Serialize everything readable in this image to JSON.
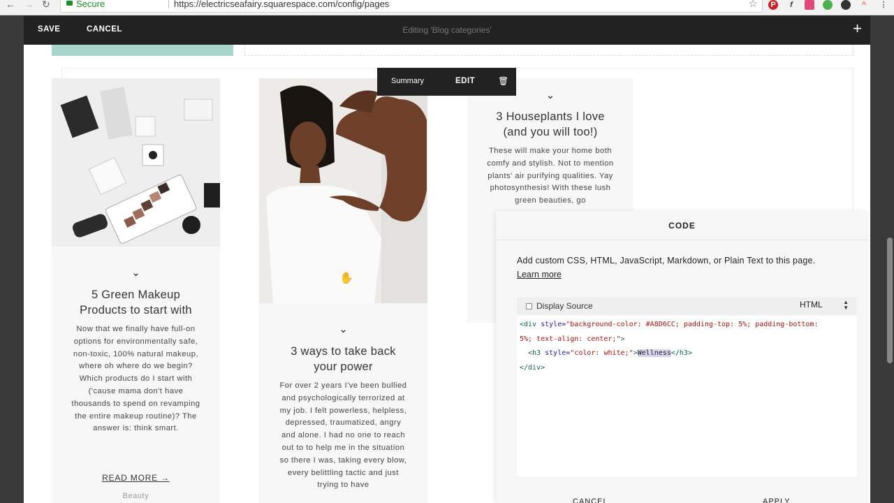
{
  "browser": {
    "secure_label": "Secure",
    "url": "https://electricseafairy.squarespace.com/config/pages"
  },
  "editor": {
    "save_label": "SAVE",
    "cancel_label": "CANCEL",
    "title": "Editing 'Blog categories'",
    "add_symbol": "+"
  },
  "toolbar": {
    "summary_label": "Summary",
    "edit_label": "EDIT"
  },
  "cards": [
    {
      "title_line1": "5 Green Makeup",
      "title_line2": "Products to start with",
      "excerpt": "Now that we finally have full-on options for environmentally safe, non-toxic, 100% natural makeup, where oh where do we begin? Which products do I start with ('cause mama don't have thousands to spend on revamping the entire makeup routine)?  The answer is: think smart.",
      "read_more": "READ MORE →",
      "category": "Beauty"
    },
    {
      "title_line1": "3 ways to take back",
      "title_line2": "your power",
      "excerpt": "For over 2 years I've been bullied and psychologically terrorized at my job.  I felt powerless, helpless, depressed, traumatized, angry and alone. I had no one to reach out to to help me in the situation so there I was, taking every blow, every belittling tactic and just trying to have"
    },
    {
      "title_line1": "3 Houseplants I love",
      "title_line2": "(and you will too!)",
      "excerpt": "These will make your home both comfy and stylish.  Not to mention plants' air purifying qualities. Yay photosynthesis! With these lush green beauties, go"
    }
  ],
  "code_panel": {
    "title": "CODE",
    "description": "Add custom CSS, HTML, JavaScript, Markdown, or Plain Text to this page.",
    "learn_more": "Learn more",
    "display_source_label": "Display Source",
    "language": "HTML",
    "code_lines": [
      "<div style=\"background-color: #A8D6CC; padding-top: 5%; padding-bottom:",
      "5%; text-align: center;\">",
      "  <h3 style=\"color: white;\">Wellness</h3>",
      "</div>"
    ],
    "cancel_label": "CANCEL",
    "apply_label": "APPLY"
  },
  "colors": {
    "accent_teal": "#A8D6CC",
    "editor_bar": "#222222"
  }
}
